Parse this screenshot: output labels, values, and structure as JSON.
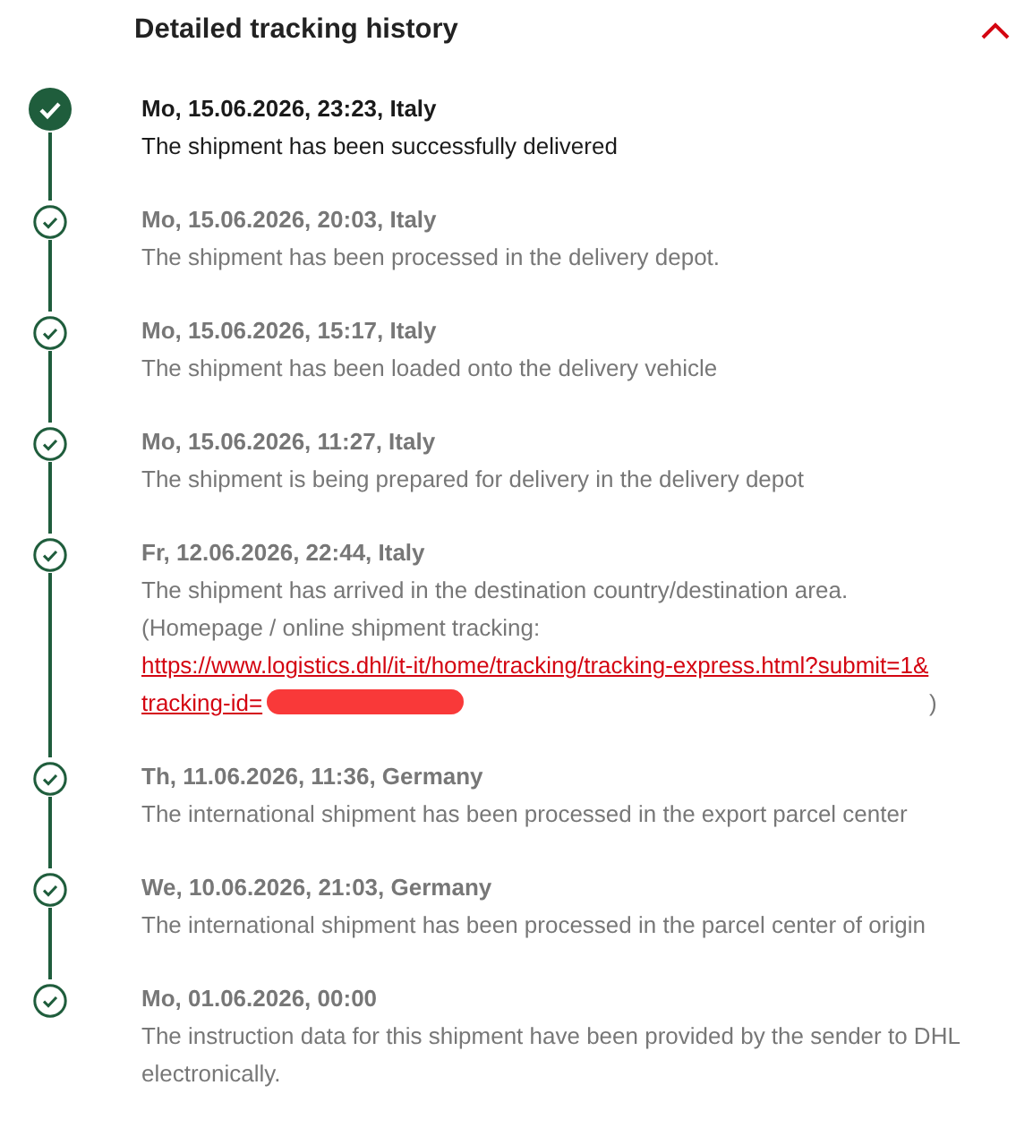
{
  "title": "Detailed tracking history",
  "expanded": true,
  "events": [
    {
      "date": "Mo, 15.06.2026, 23:23, Italy",
      "text": "The shipment has been successfully delivered",
      "current": true
    },
    {
      "date": "Mo, 15.06.2026, 20:03, Italy",
      "text": "The shipment has been processed in the delivery depot.",
      "current": false
    },
    {
      "date": "Mo, 15.06.2026, 15:17, Italy",
      "text": "The shipment has been loaded onto the delivery vehicle",
      "current": false
    },
    {
      "date": "Mo, 15.06.2026, 11:27, Italy",
      "text": "The shipment is being prepared for delivery in the delivery depot",
      "current": false
    },
    {
      "date": "Fr, 12.06.2026, 22:44, Italy",
      "text": "The shipment has arrived in the destination country/destination area.",
      "note": "(Homepage / online shipment tracking:",
      "link": "https://www.logistics.dhl/it-it/home/tracking/tracking-express.html?submit=1&tracking-id=",
      "note_end": ")",
      "current": false
    },
    {
      "date": "Th, 11.06.2026, 11:36, Germany",
      "text": "The international shipment has been processed in the export parcel center",
      "current": false
    },
    {
      "date": "We, 10.06.2026, 21:03, Germany",
      "text": "The international shipment has been processed in the parcel center of origin",
      "current": false
    },
    {
      "date": "Mo, 01.06.2026, 00:00",
      "text": "The instruction data for this shipment have been provided by the sender to DHL electronically.",
      "current": false
    }
  ]
}
